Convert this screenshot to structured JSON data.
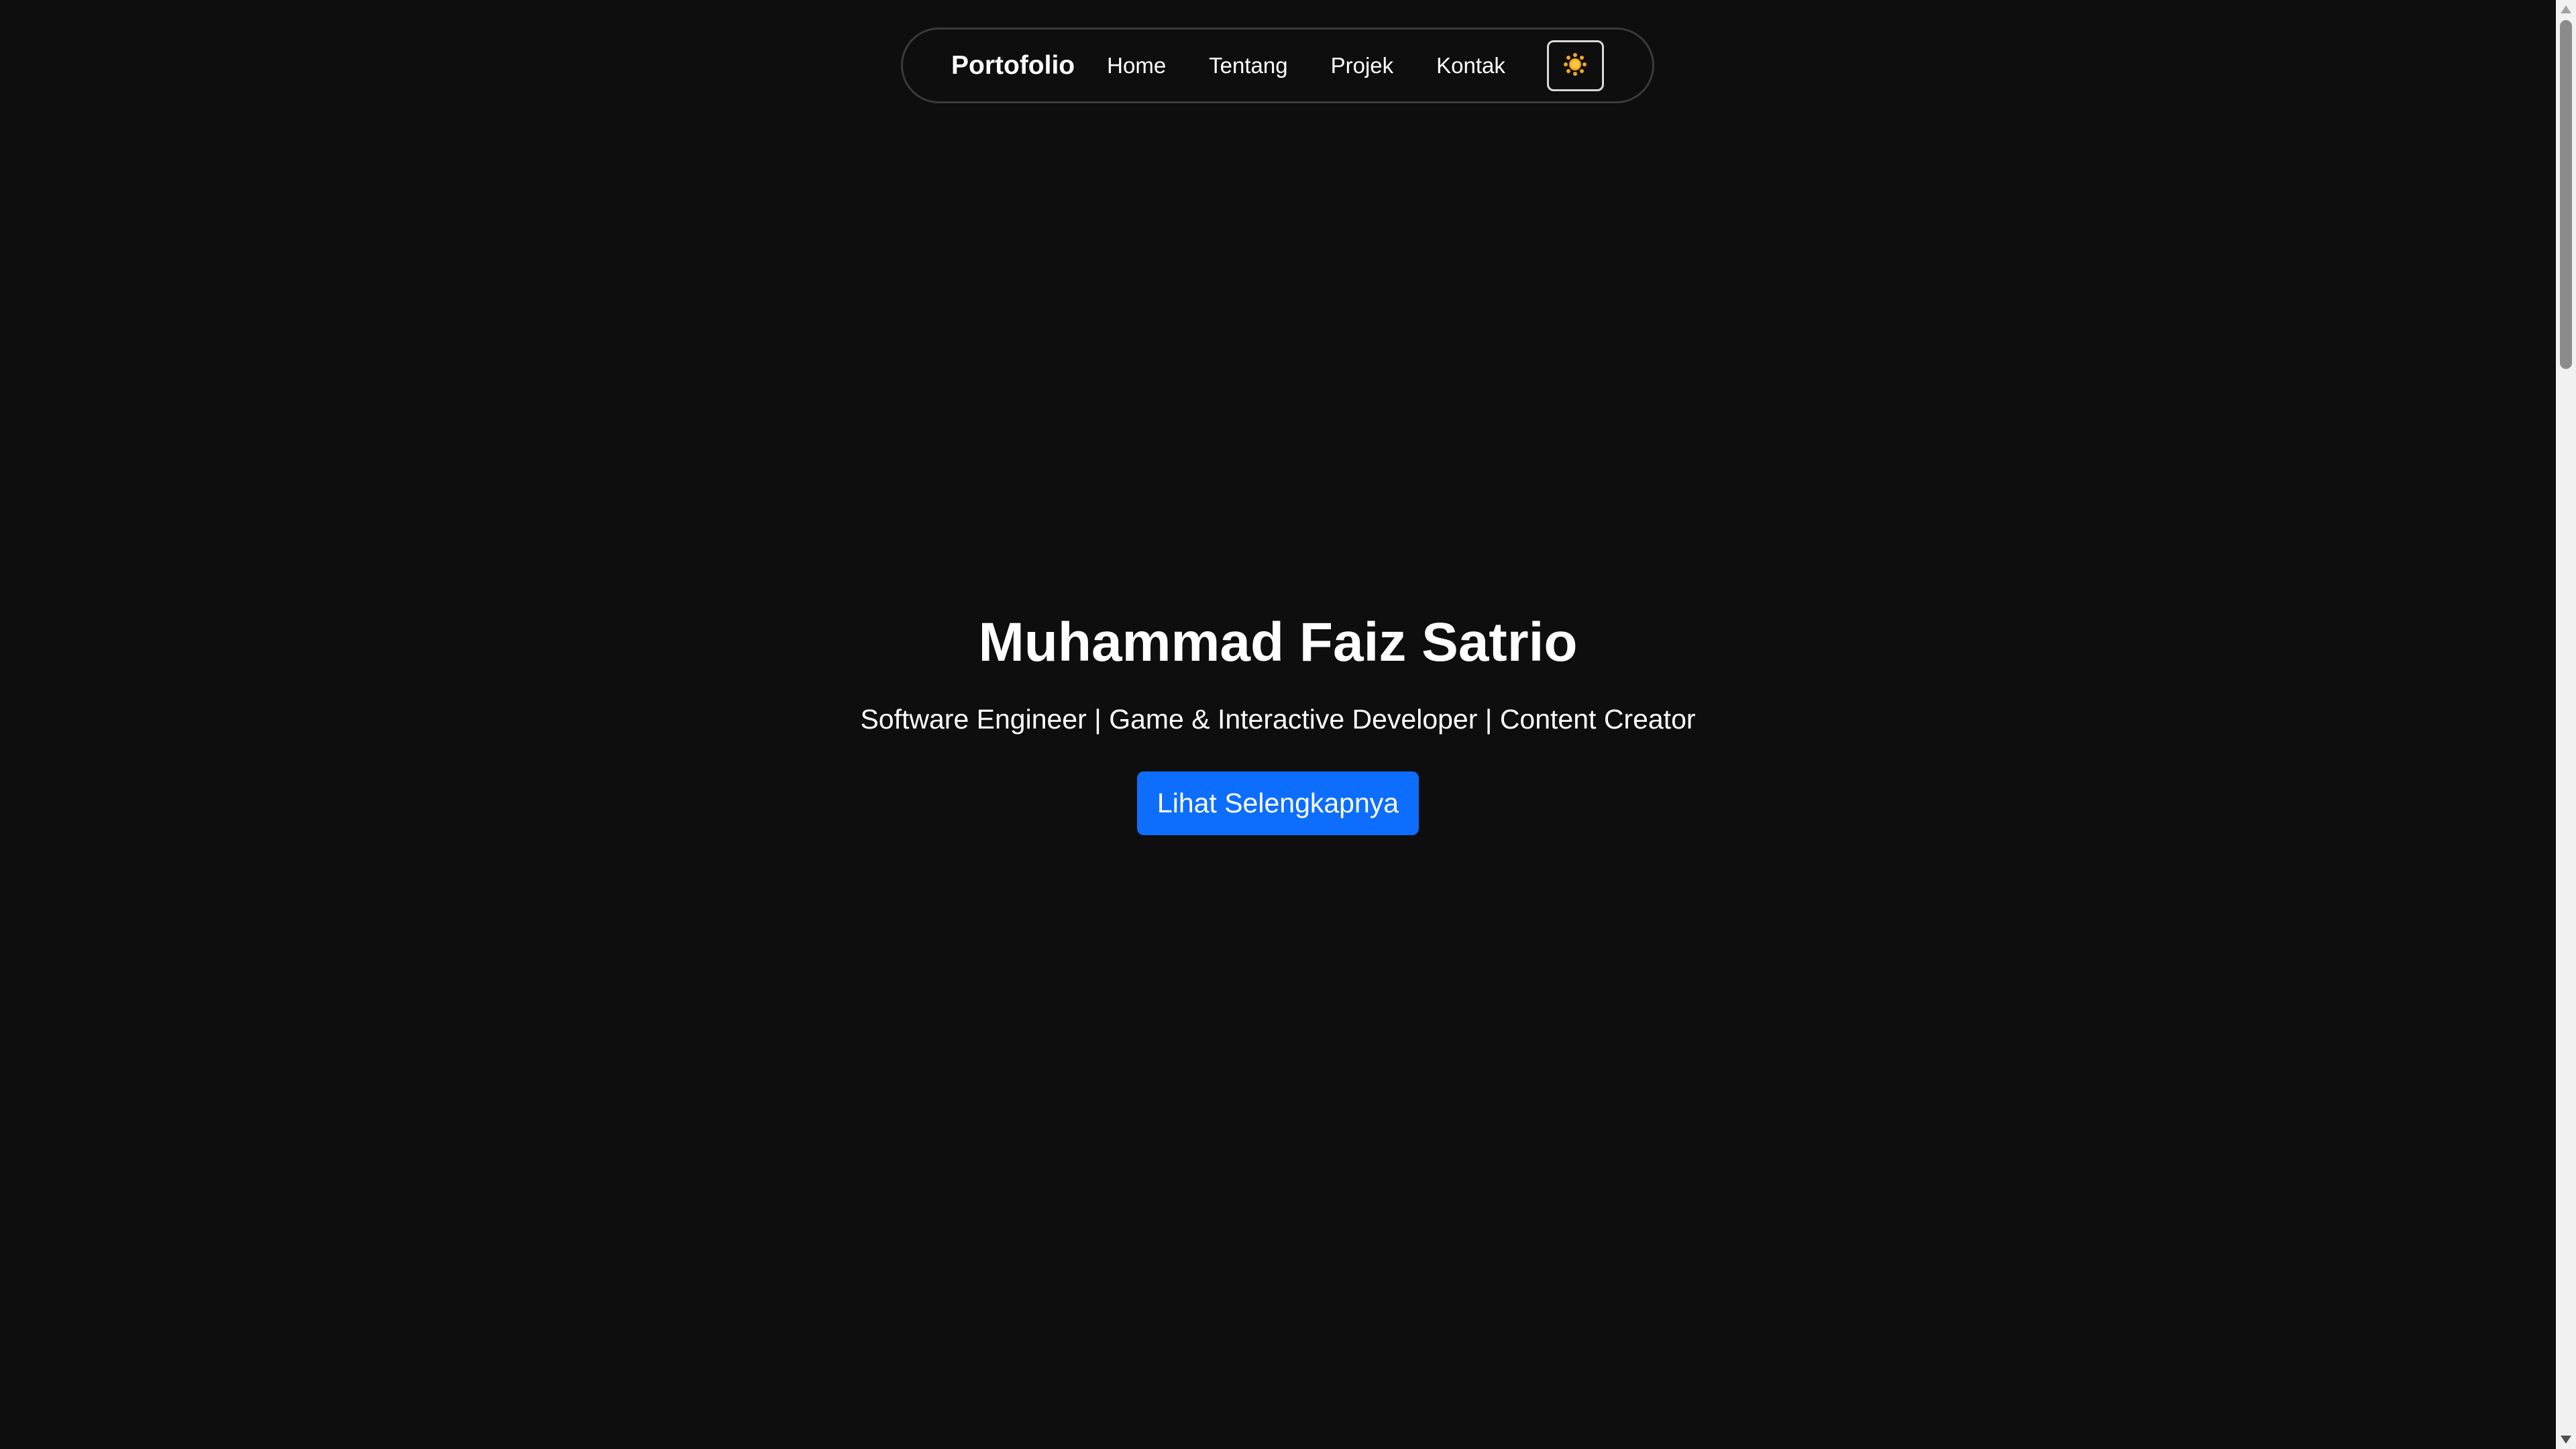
{
  "navbar": {
    "brand": "Portofolio",
    "links": [
      "Home",
      "Tentang",
      "Projek",
      "Kontak"
    ],
    "theme_toggle_icon": "sun-icon"
  },
  "hero": {
    "title": "Muhammad Faiz Satrio",
    "subtitle": "Software Engineer | Game & Interactive Developer | Content Creator",
    "button_label": "Lihat Selengkapnya"
  },
  "colors": {
    "background": "#0e0e0e",
    "accent": "#0d6efd",
    "sun": "#f5a623"
  }
}
